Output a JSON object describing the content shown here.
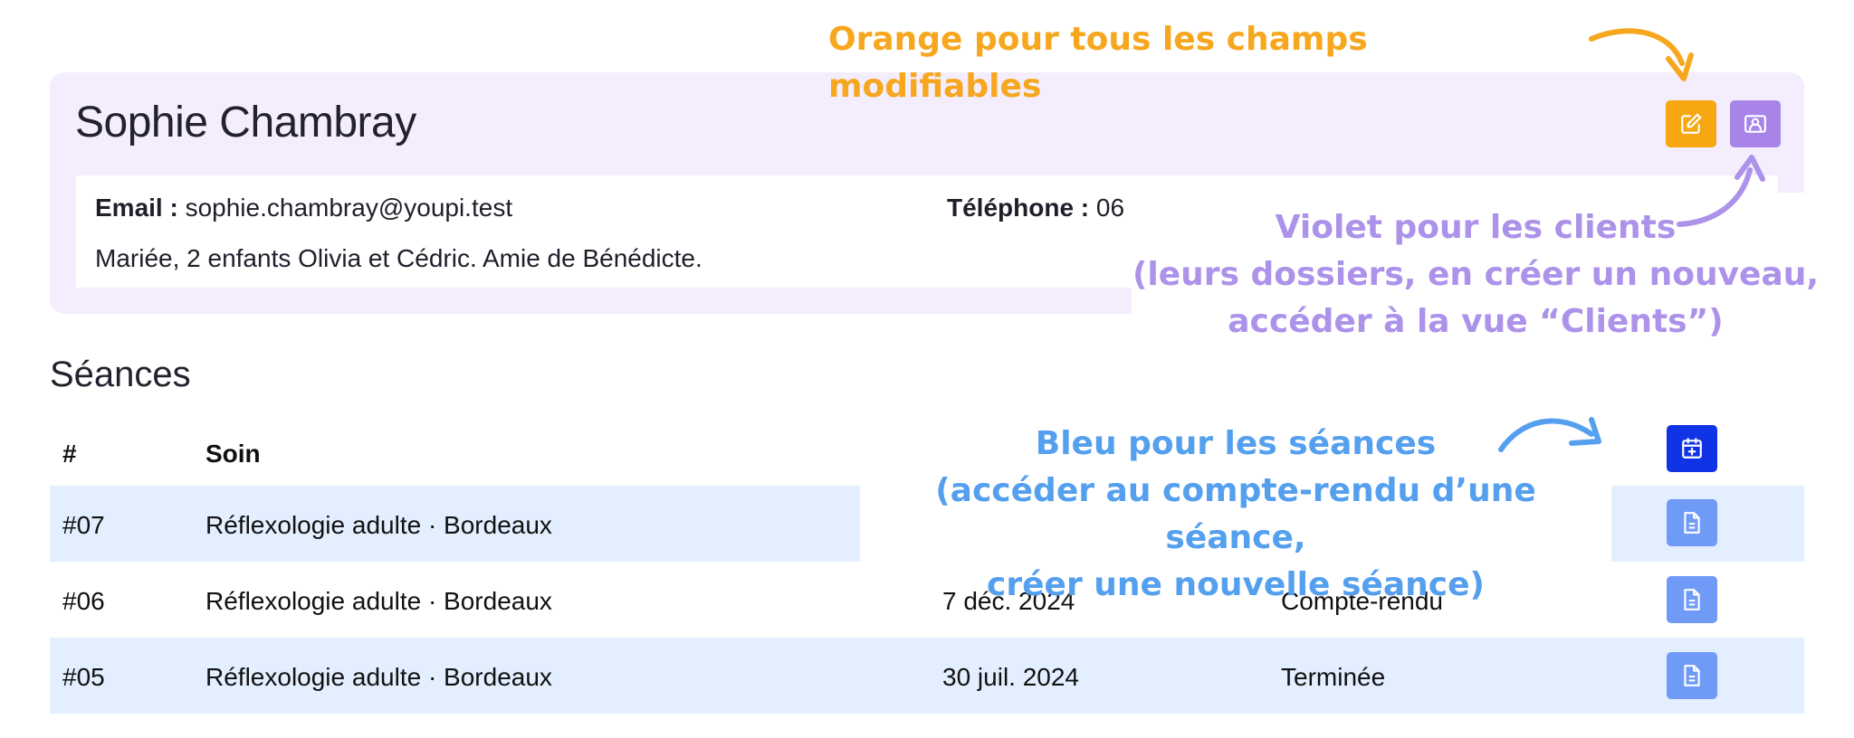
{
  "client": {
    "name": "Sophie Chambray",
    "email_label": "Email :",
    "email": "sophie.chambray@youpi.test",
    "phone_label": "Téléphone :",
    "phone": "06",
    "notes": "Mariée, 2 enfants Olivia et Cédric. Amie de Bénédicte.",
    "edit_icon": "pencil-square-icon",
    "clients_icon": "contact-card-icon"
  },
  "sessions": {
    "title": "Séances",
    "columns": [
      "#",
      "Soin"
    ],
    "new_session_icon": "calendar-plus-icon",
    "report_icon": "document-icon",
    "rows": [
      {
        "num": "#07",
        "soin": "Réflexologie adulte · Bordeaux",
        "date": "",
        "status": ""
      },
      {
        "num": "#06",
        "soin": "Réflexologie adulte · Bordeaux",
        "date": "7 déc. 2024",
        "status": "Compte-rendu"
      },
      {
        "num": "#05",
        "soin": "Réflexologie adulte · Bordeaux",
        "date": "30 juil. 2024",
        "status": "Terminée"
      }
    ]
  },
  "annotations": {
    "orange": "Orange pour tous les champs modifiables",
    "violet": [
      "Violet pour les clients",
      "(leurs dossiers, en créer un nouveau,",
      "accéder à la vue “Clients”)"
    ],
    "blue": [
      "Bleu pour les séances",
      "(accéder au compte-rendu d’une séance,",
      "créer une nouvelle séance)"
    ]
  },
  "colors": {
    "orange": "#f7a70f",
    "violet": "#a884e8",
    "blue_dark": "#1033e6",
    "blue_light": "#6f9bf7",
    "card_bg": "#f3edfd",
    "row_tint": "#e3eeff"
  }
}
